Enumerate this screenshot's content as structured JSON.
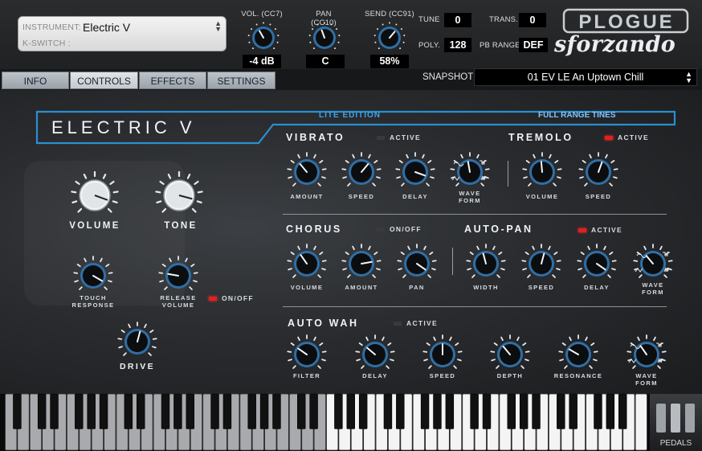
{
  "header": {
    "instrument": {
      "label": "INSTRUMENT:",
      "value": "Electric V",
      "kswitch_label": "K-SWITCH :"
    },
    "controls": [
      {
        "name": "vol",
        "label": "VOL. (CC7)",
        "value": "-4 dB"
      },
      {
        "name": "pan",
        "label": "PAN (CC10)",
        "value": "C"
      },
      {
        "name": "send",
        "label": "SEND (CC91)",
        "value": "58%"
      }
    ],
    "tune": {
      "label": "TUNE",
      "value": "0"
    },
    "trans": {
      "label": "TRANS.",
      "value": "0"
    },
    "poly": {
      "label": "POLY.",
      "value": "128"
    },
    "pb_range": {
      "label": "PB RANGE",
      "value": "DEF"
    },
    "logo_top": "PLOGUE",
    "logo_bottom": "sforzando"
  },
  "tabs": [
    {
      "label": "INFO"
    },
    {
      "label": "CONTROLS"
    },
    {
      "label": "EFFECTS"
    },
    {
      "label": "SETTINGS"
    }
  ],
  "snapshot": {
    "label": "SNAPSHOT",
    "value": "01 EV LE An Uptown Chill"
  },
  "panel": {
    "title": "ELECTRIC V",
    "edition": "LITE EDITION",
    "preset_tag": "FULL RANGE TINES",
    "left_knobs": {
      "volume": "VOLUME",
      "tone": "TONE",
      "touch": [
        "TOUCH",
        "RESPONSE"
      ],
      "release": [
        "RELEASE",
        "VOLUME"
      ],
      "onoff": "ON/OFF",
      "drive": "DRIVE"
    },
    "vibrato": {
      "title": "VIBRATO",
      "active": "ACTIVE",
      "knobs": [
        "AMOUNT",
        "SPEED",
        "DELAY"
      ],
      "wave": [
        "WAVE",
        "FORM"
      ]
    },
    "tremolo": {
      "title": "TREMOLO",
      "active": "ACTIVE",
      "knobs": [
        "VOLUME",
        "SPEED"
      ]
    },
    "chorus": {
      "title": "CHORUS",
      "active": "ON/OFF",
      "knobs": [
        "VOLUME",
        "AMOUNT",
        "PAN"
      ]
    },
    "autopan": {
      "title": "AUTO-PAN",
      "active": "ACTIVE",
      "knobs": [
        "WIDTH",
        "SPEED",
        "DELAY"
      ],
      "wave": [
        "WAVE",
        "FORM"
      ]
    },
    "autowah": {
      "title": "AUTO WAH",
      "active": "ACTIVE",
      "knobs": [
        "FILTER",
        "DELAY",
        "SPEED",
        "DEPTH",
        "RESONANCE"
      ],
      "wave": [
        "WAVE",
        "FORM"
      ]
    }
  },
  "keyboard": {
    "pedals_label": "PEDALS"
  },
  "colors": {
    "accent": "#2f6fa6",
    "led_on": "#e02020",
    "panel_outline": "#2a8fd0"
  }
}
